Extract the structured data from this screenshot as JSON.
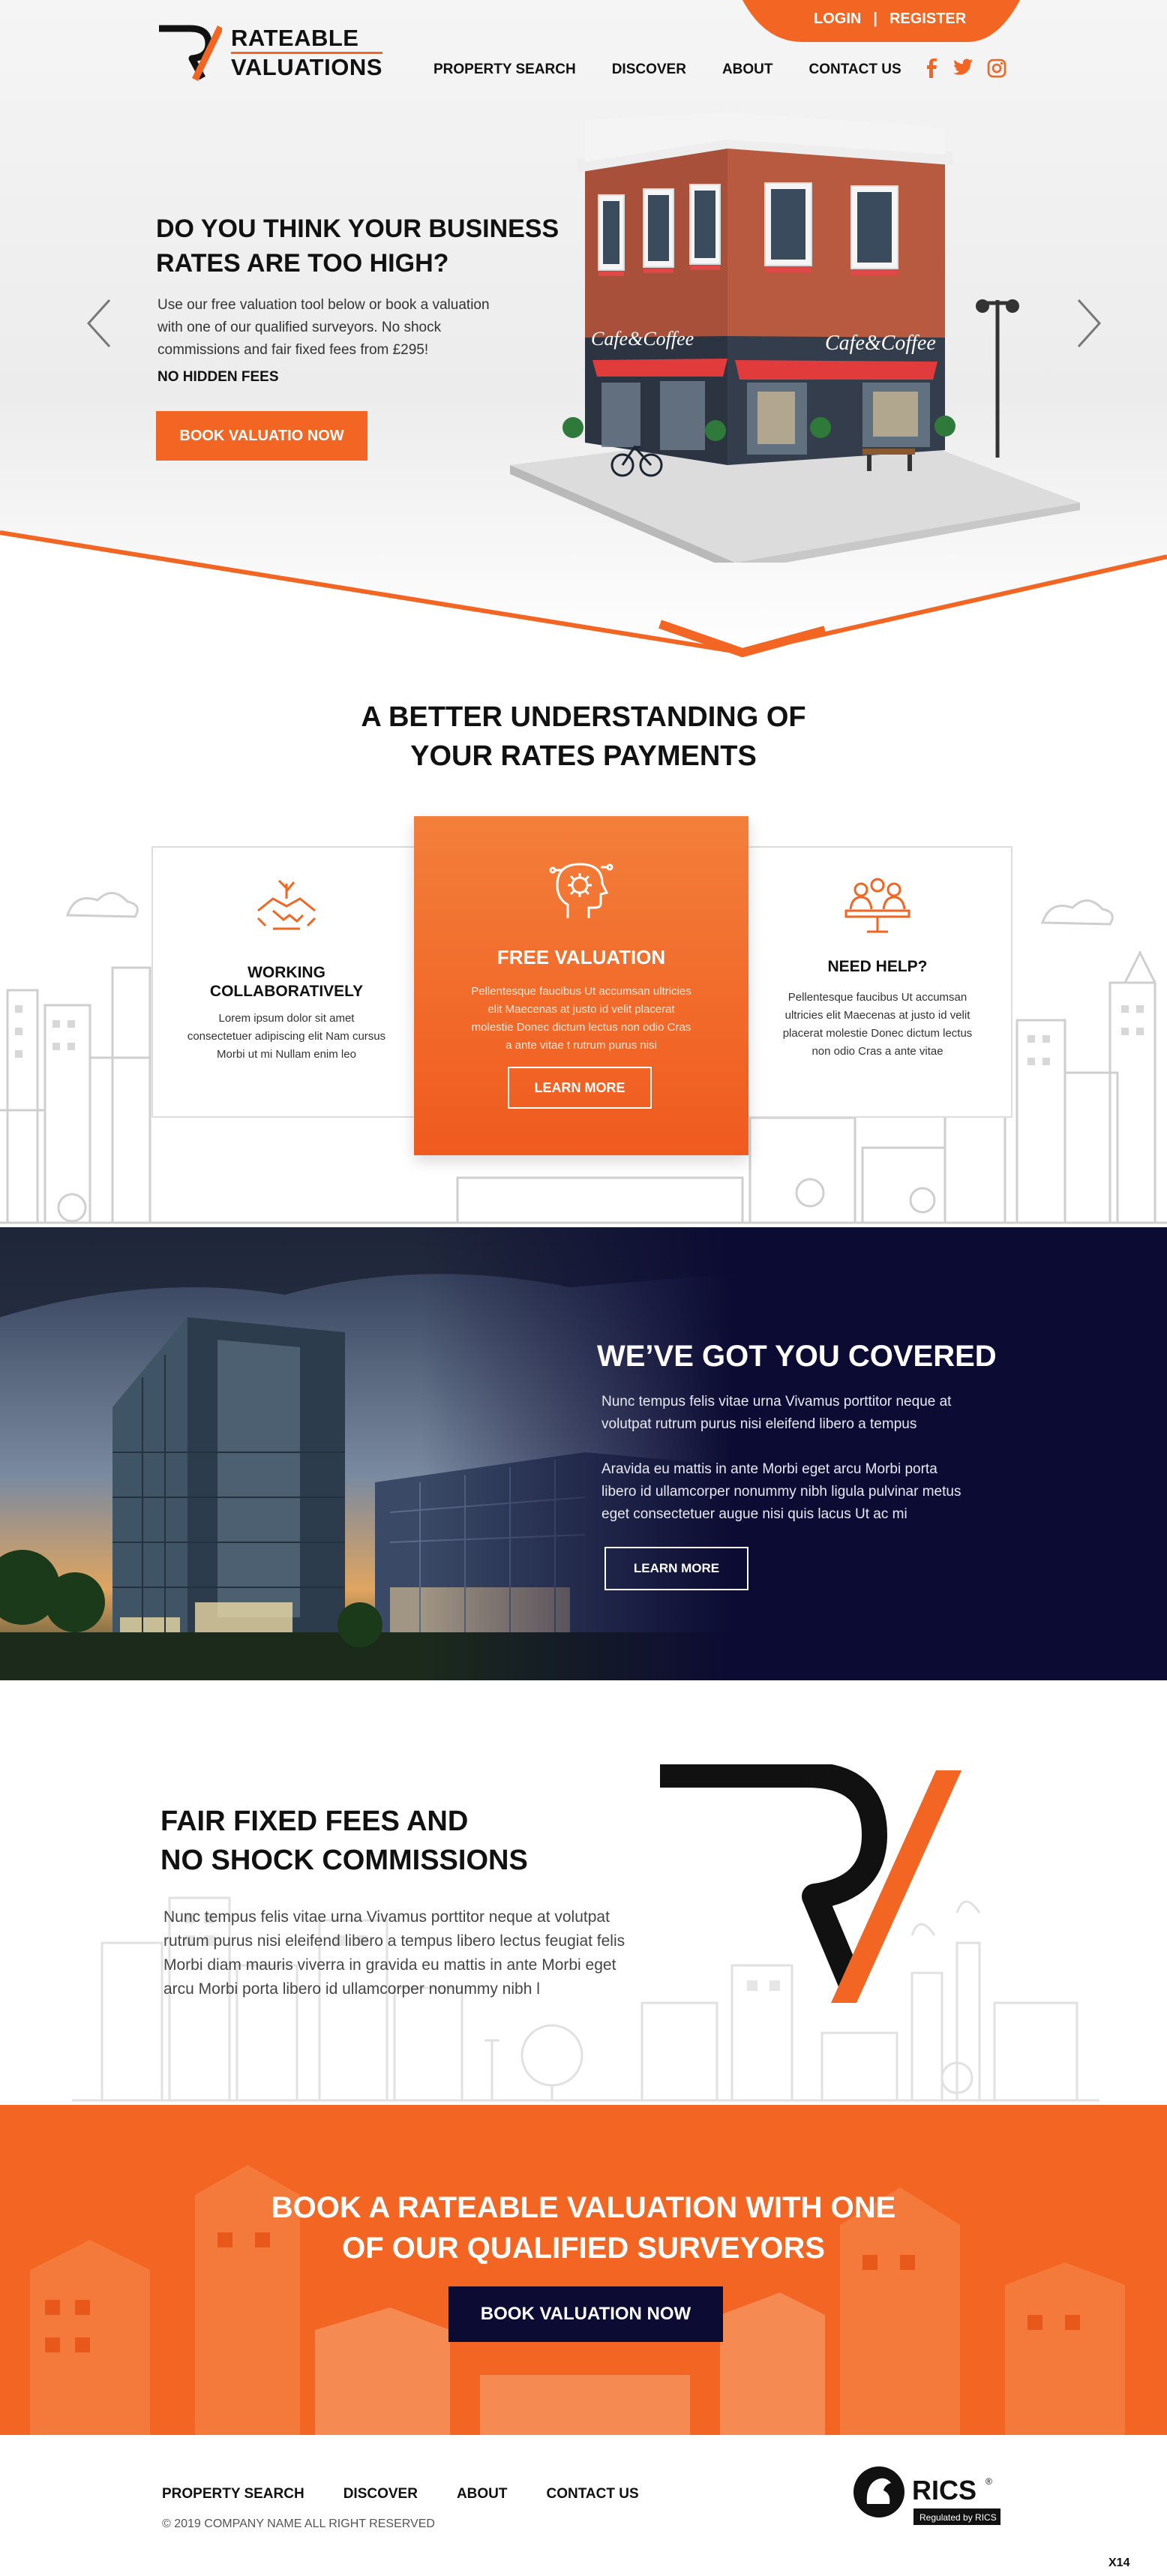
{
  "header": {
    "logo_line1": "RATEABLE",
    "logo_line2": "VALUATIONS",
    "login": "LOGIN",
    "separator": "|",
    "register": "REGISTER",
    "nav": [
      "PROPERTY SEARCH",
      "DISCOVER",
      "ABOUT",
      "CONTACT US"
    ],
    "social": [
      "facebook-icon",
      "twitter-icon",
      "instagram-icon"
    ]
  },
  "hero": {
    "title_line1": "DO YOU THINK YOUR BUSINESS",
    "title_line2": "RATES ARE TOO HIGH?",
    "desc_line1": "Use our free valuation tool below or book a valuation",
    "desc_line2": "with one of our qualified surveyors. No shock",
    "desc_line3": "commissions and fair fixed fees from £295!",
    "no_fees": "NO HIDDEN FEES",
    "button": "BOOK VALUATIO NOW",
    "sign_left": "Cafe&Coffee",
    "sign_right": "Cafe&Coffee"
  },
  "understanding": {
    "title_line1": "A BETTER UNDERSTANDING OF",
    "title_line2": "YOUR RATES PAYMENTS",
    "cards": [
      {
        "icon": "handshake-icon",
        "title_line1": "WORKING",
        "title_line2": "COLLABORATIVELY",
        "text_line1": "Lorem ipsum dolor sit amet",
        "text_line2": "consectetuer adipiscing elit Nam cursus",
        "text_line3": "Morbi ut mi Nullam enim leo"
      },
      {
        "icon": "brain-gear-icon",
        "title_line1": "FREE VALUATION",
        "text_line1": "Pellentesque faucibus Ut accumsan ultricies",
        "text_line2": "elit Maecenas at justo id velit placerat",
        "text_line3": "molestie Donec dictum lectus non odio Cras",
        "text_line4": "a ante vitae t rutrum purus nisi",
        "button": "LEARN MORE"
      },
      {
        "icon": "team-meeting-icon",
        "title_line1": "NEED HELP?",
        "text_line1": "Pellentesque faucibus Ut accumsan",
        "text_line2": "ultricies elit Maecenas at justo id velit",
        "text_line3": "placerat molestie Donec dictum lectus",
        "text_line4": "non odio Cras a ante vitae"
      }
    ]
  },
  "covered": {
    "title": "WE’VE GOT YOU COVERED",
    "p1_line1": "Nunc tempus felis vitae urna Vivamus porttitor neque at",
    "p1_line2": "volutpat rutrum purus nisi eleifend libero a tempus",
    "p2_line1": "Aravida eu mattis in ante Morbi eget arcu Morbi porta",
    "p2_line2": "libero id ullamcorper nonummy nibh ligula pulvinar metus",
    "p2_line3": "eget consectetuer augue nisi quis lacus Ut ac mi",
    "button": "LEARN MORE"
  },
  "fees": {
    "title_line1": "FAIR FIXED FEES AND",
    "title_line2": "NO SHOCK COMMISSIONS",
    "p_line1": "Nunc tempus felis vitae urna Vivamus porttitor neque at volutpat",
    "p_line2": "rutrum purus nisi eleifend libero a tempus libero lectus feugiat felis",
    "p_line3": "Morbi diam mauris viverra in gravida eu mattis in ante Morbi eget",
    "p_line4": "arcu Morbi porta libero id ullamcorper nonummy nibh l"
  },
  "book": {
    "title_line1": "BOOK A RATEABLE VALUATION WITH ONE",
    "title_line2": "OF OUR QUALIFIED SURVEYORS",
    "button": "BOOK VALUATION NOW"
  },
  "footer": {
    "nav": [
      "PROPERTY SEARCH",
      "DISCOVER",
      "ABOUT",
      "CONTACT US"
    ],
    "copyright": "© 2019 COMPANY NAME  ALL RIGHT RESERVED",
    "rics_name": "RICS",
    "rics_reg": "®",
    "rics_tag": "Regulated by RICS",
    "page_mark": "X14"
  },
  "colors": {
    "accent": "#f26522",
    "navy": "#0c0b33",
    "text": "#111111"
  }
}
